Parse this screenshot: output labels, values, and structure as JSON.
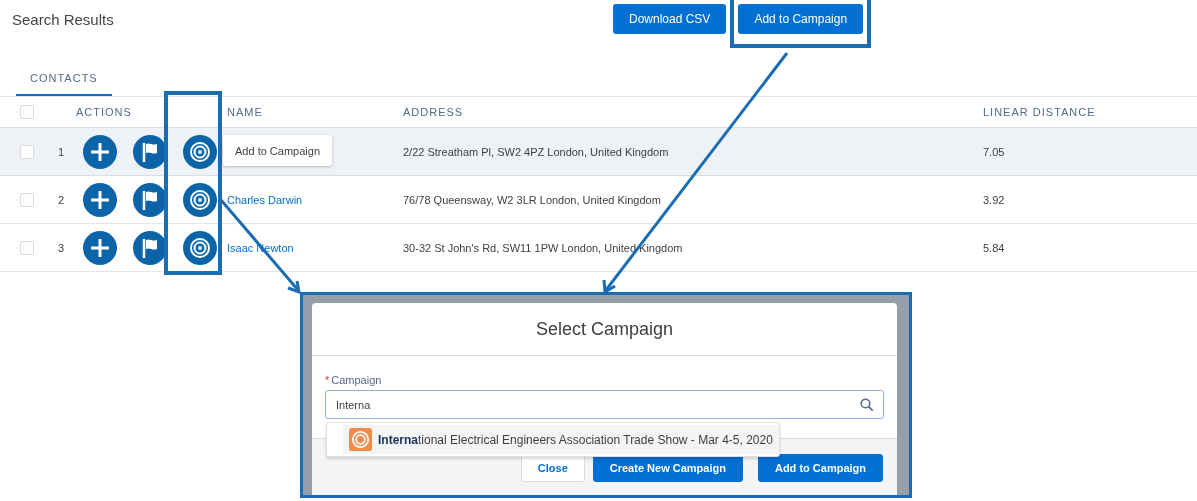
{
  "header": {
    "title": "Search Results",
    "buttons": [
      {
        "label": "Download CSV",
        "highlighted": false
      },
      {
        "label": "Add to Campaign",
        "highlighted": true
      }
    ]
  },
  "tabs": [
    {
      "label": "CONTACTS",
      "selected": true
    }
  ],
  "table": {
    "select_all_checked": false,
    "target_actions_highlighted": true,
    "columns": [
      "ACTIONS",
      "NAME",
      "ADDRESS",
      "LINEAR DISTANCE"
    ],
    "rows": [
      {
        "checked": false,
        "hovered": true,
        "index": "1",
        "tooltip": "Add to Campaign",
        "address": "2/22 Streatham Pl, SW2 4PZ London, United Kingdom",
        "distance": "7.05"
      },
      {
        "checked": false,
        "hovered": false,
        "index": "2",
        "name": "Charles Darwin",
        "address": "76/78 Queensway, W2 3LR London, United Kingdom",
        "distance": "3.92"
      },
      {
        "checked": false,
        "hovered": false,
        "index": "3",
        "name": "Isaac Newton",
        "address": "30-32 St John's Rd, SW11 1PW London, United Kingdom",
        "distance": "5.84"
      }
    ]
  },
  "modal": {
    "title": "Select Campaign",
    "field": {
      "label": "Campaign",
      "required_mark": "*",
      "value": "Interna"
    },
    "suggestions": [
      {
        "text": "**Interna**tional Electrical Engineers Association Trade Show - Mar 4-5, 2020"
      }
    ],
    "buttons": [
      {
        "label": "Close",
        "kind": "neutral"
      },
      {
        "label": "Create New Campaign",
        "kind": "brand"
      },
      {
        "label": "Add to Campaign",
        "kind": "brand"
      }
    ]
  }
}
